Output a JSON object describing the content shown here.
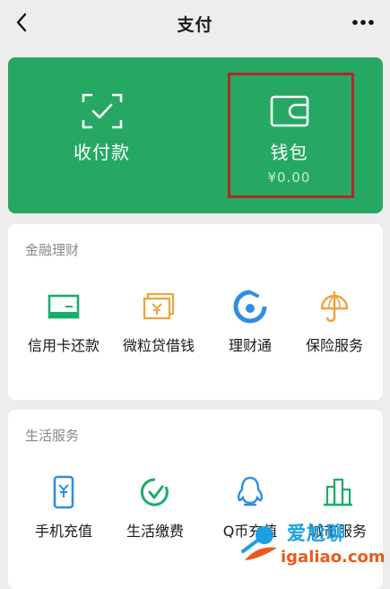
{
  "header": {
    "title": "支付",
    "back_icon": "chevron-left-icon",
    "more_icon": "more-dots-icon"
  },
  "wallet_card": {
    "color": "#26a864",
    "receive_pay": {
      "label": "收付款",
      "icon": "scan-check-icon"
    },
    "wallet": {
      "label": "钱包",
      "balance": "¥0.00",
      "icon": "wallet-icon"
    },
    "highlight_color": "#b0282a"
  },
  "finance": {
    "title": "金融理财",
    "items": [
      {
        "label": "信用卡还款",
        "icon": "credit-card-icon"
      },
      {
        "label": "微粒贷借钱",
        "icon": "loan-bill-icon"
      },
      {
        "label": "理财通",
        "icon": "wealth-icon"
      },
      {
        "label": "保险服务",
        "icon": "insurance-umbrella-icon"
      }
    ]
  },
  "life": {
    "title": "生活服务",
    "items": [
      {
        "label": "手机充值",
        "icon": "phone-topup-icon"
      },
      {
        "label": "生活缴费",
        "icon": "utility-payment-icon"
      },
      {
        "label": "Q币充值",
        "icon": "qq-penguin-icon"
      },
      {
        "label": "城市服务",
        "icon": "city-buildings-icon"
      }
    ]
  },
  "watermark": {
    "line1": "爱尬聊",
    "line2": "igaliao.com"
  }
}
